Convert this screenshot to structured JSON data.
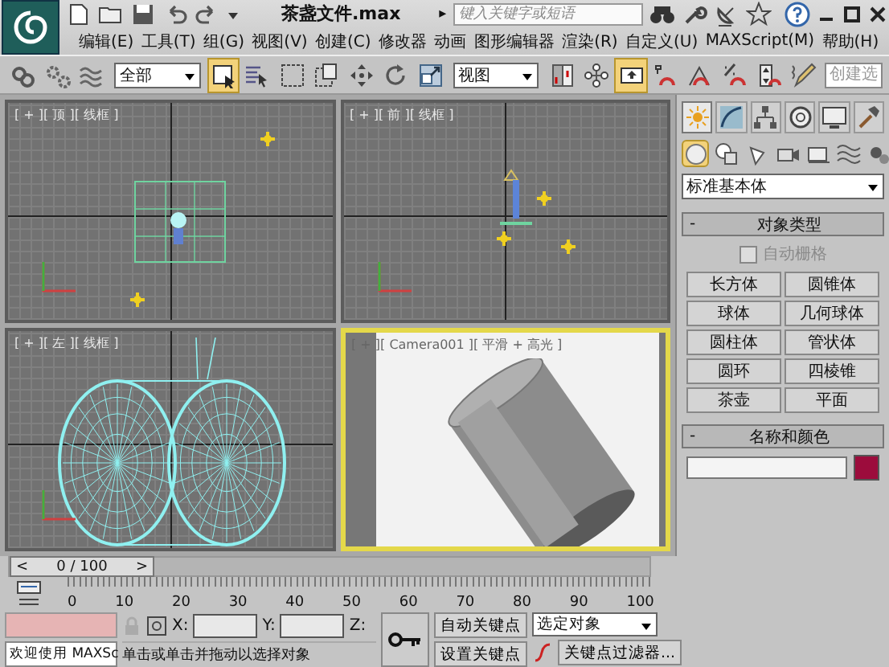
{
  "title_bar": {
    "filename": "茶盏文件.max",
    "search_arrow": "▸",
    "search": {
      "placeholder": "键入关键字或短语"
    }
  },
  "menu": [
    "编辑(E)",
    "工具(T)",
    "组(G)",
    "视图(V)",
    "创建(C)",
    "修改器",
    "动画",
    "图形编辑器",
    "渲染(R)",
    "自定义(U)",
    "MAXScript(M)",
    "帮助(H)"
  ],
  "toolbar": [
    {
      "kind": "button",
      "selected": false
    },
    {
      "kind": "button",
      "selected": false
    },
    {
      "kind": "button",
      "selected": false
    },
    {
      "kind": "dropdown",
      "value": "全部"
    },
    {
      "kind": "button",
      "selected": true
    },
    {
      "kind": "button",
      "selected": false
    },
    {
      "kind": "button",
      "selected": false
    },
    {
      "kind": "button",
      "selected": false
    },
    {
      "kind": "button",
      "selected": false
    },
    {
      "kind": "button",
      "selected": false
    },
    {
      "kind": "button",
      "selected": false
    },
    {
      "kind": "dropdown",
      "value": "视图"
    },
    {
      "kind": "button",
      "selected": false
    },
    {
      "kind": "button",
      "selected": false
    },
    {
      "kind": "button",
      "selected": true
    },
    {
      "kind": "button",
      "selected": false
    },
    {
      "kind": "button",
      "selected": false
    },
    {
      "kind": "button",
      "selected": false
    },
    {
      "kind": "button",
      "selected": false
    },
    {
      "kind": "button",
      "selected": false
    },
    {
      "kind": "field",
      "placeholder": "创建选"
    }
  ],
  "viewports": [
    {
      "label": "[ + ][ 顶 ][ 线框 ]",
      "kind": "top",
      "active": false
    },
    {
      "label": "[ + ][ 前 ][ 线框 ]",
      "kind": "front",
      "active": false
    },
    {
      "label": "[ + ][ 左 ][ 线框 ]",
      "kind": "left",
      "active": false
    },
    {
      "label": "[ + ][ Camera001 ][ 平滑 + 高光 ]",
      "kind": "camera",
      "active": true
    }
  ],
  "command_panel": {
    "tabs": [
      {
        "selected": true
      },
      {
        "selected": false
      },
      {
        "selected": false
      },
      {
        "selected": false
      },
      {
        "selected": false
      },
      {
        "selected": false
      }
    ],
    "categories": [
      {
        "selected": true
      },
      {
        "selected": false
      },
      {
        "selected": false
      },
      {
        "selected": false
      },
      {
        "selected": false
      },
      {
        "selected": false
      },
      {
        "selected": false
      }
    ],
    "type_dropdown": "标准基本体",
    "object_type": {
      "sign": "-",
      "title": "对象类型",
      "auto_grid": {
        "label": "自动栅格",
        "checked": false,
        "disabled": true
      },
      "buttons": [
        "长方体",
        "圆锥体",
        "球体",
        "几何球体",
        "圆柱体",
        "管状体",
        "圆环",
        "四棱锥",
        "茶壶",
        "平面"
      ]
    },
    "name_color": {
      "sign": "-",
      "title": "名称和颜色",
      "color": "#9c0c3c"
    }
  },
  "timeline": {
    "prev": "<",
    "position": "0 / 100",
    "next": ">",
    "level": 0
  },
  "ruler": [
    "0",
    "10",
    "20",
    "30",
    "40",
    "50",
    "60",
    "70",
    "80",
    "90",
    "100"
  ],
  "status": {
    "welcome": "欢迎使用 MAXSc",
    "prompt": "单击或单击并拖动以选择对象",
    "x_label": "X:",
    "y_label": "Y:",
    "z_label": "Z:",
    "auto_key": "自动关键点",
    "set_key": "设置关键点",
    "key_target": "选定对象",
    "key_filters": "关键点过滤器..."
  }
}
